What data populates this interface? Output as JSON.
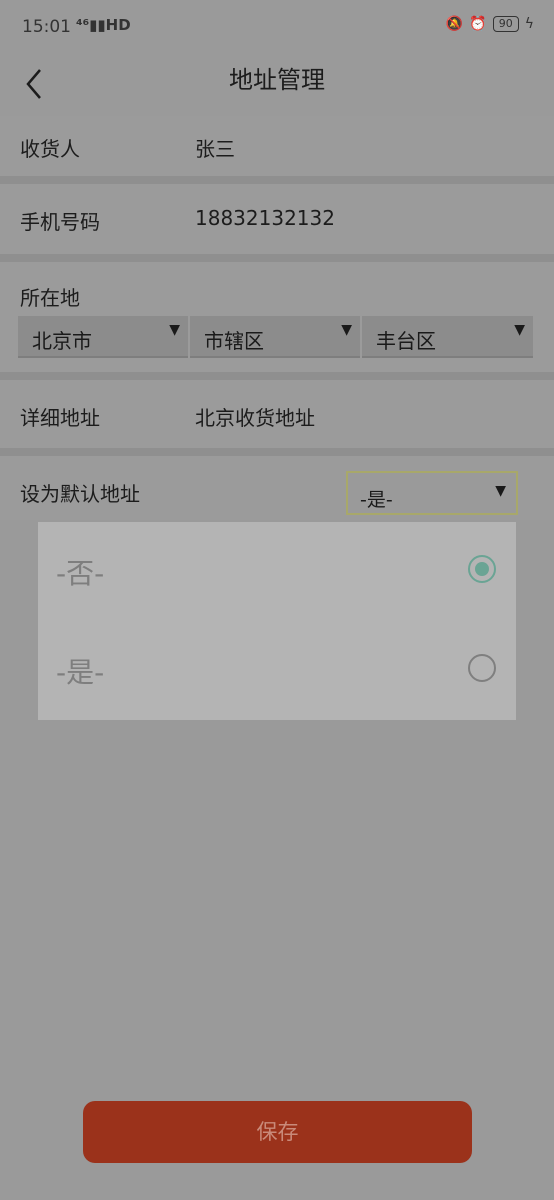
{
  "status": {
    "time": "15:01",
    "signal": "⁴⁶▮▮HD",
    "battery": "90"
  },
  "header": {
    "title": "地址管理"
  },
  "form": {
    "receiver": {
      "label": "收货人",
      "value": "张三"
    },
    "phone": {
      "label": "手机号码",
      "value": "18832132132"
    },
    "location": {
      "label": "所在地",
      "province": "北京市",
      "city": "市辖区",
      "district": "丰台区"
    },
    "detail": {
      "label": "详细地址",
      "value": "北京收货地址"
    },
    "default": {
      "label": "设为默认地址",
      "value": "-是-"
    }
  },
  "dropdown": {
    "options": [
      {
        "label": "-否-",
        "checked": true
      },
      {
        "label": "-是-",
        "checked": false
      }
    ]
  },
  "save_label": "保存"
}
